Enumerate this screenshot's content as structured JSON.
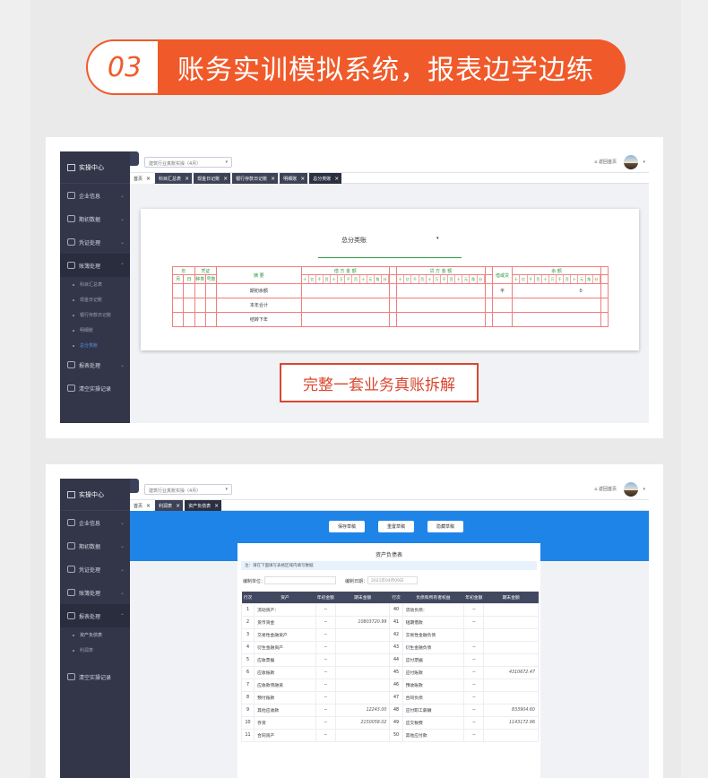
{
  "banner": {
    "number": "03",
    "title": "账务实训模拟系统，报表边学边练"
  },
  "shared": {
    "app_title": "实操中心",
    "menu": [
      "企业信息",
      "期初数据",
      "凭证处理",
      "账簿处理",
      "报表处理",
      "清空实操记录"
    ],
    "industry_select": "建筑行业真账实操（4月）",
    "home_link": "返回首页"
  },
  "shot1": {
    "submenu": [
      "科目汇总表",
      "现金日记账",
      "银行存款日记账",
      "明细账",
      "总分类账"
    ],
    "tabs": [
      "首页",
      "科目汇总表",
      "现金日记账",
      "银行存款日记账",
      "明细账",
      "总分类账"
    ],
    "ledger": {
      "title": "总分类账",
      "dropdown_mark": "▾",
      "year": "年",
      "voucher": "凭证",
      "month": "月",
      "day": "日",
      "kind": "种类",
      "number": "号数",
      "summary": "摘 要",
      "debit": "借 方 金 额",
      "credit": "贷 方 金 额",
      "dc": "借或贷",
      "balance": "余 额",
      "digit_labels": [
        "十",
        "亿",
        "千",
        "百",
        "十",
        "万",
        "千",
        "百",
        "十",
        "元",
        "角",
        "分"
      ],
      "rows": [
        {
          "summary": "期初余额",
          "dc": "平",
          "balance": "0"
        },
        {
          "summary": "本年合计",
          "dc": "",
          "balance": ""
        },
        {
          "summary": "结转下年",
          "dc": "",
          "balance": ""
        }
      ]
    },
    "caption": "完整一套业务真账拆解"
  },
  "shot2": {
    "submenu": [
      "资产负债表",
      "利润表"
    ],
    "tabs": [
      "首页",
      "利润表",
      "资产负债表"
    ],
    "buttons": [
      "保存草稿",
      "重置草稿",
      "隐藏草稿"
    ],
    "report_title": "资产负债表",
    "notice": "注：请在下面填写表格区域内填写数据",
    "unit_label": "编制单位：",
    "date_label": "编制日期：",
    "date_value": "2021年04月09日",
    "columns": [
      "行次",
      "资产",
      "年初金额",
      "期末金额",
      "行次",
      "负债和所有者权益",
      "年初金额",
      "期末金额"
    ],
    "rows": [
      [
        "1",
        "流动资产：",
        "--",
        "",
        "40",
        "流动负债：",
        "--",
        ""
      ],
      [
        "2",
        "货币资金",
        "--",
        "10803720.99",
        "41",
        "短期借款",
        "--",
        ""
      ],
      [
        "3",
        "交易性金融资产",
        "--",
        "",
        "42",
        "交易性金融负债",
        "",
        ""
      ],
      [
        "4",
        "衍生金融资产",
        "--",
        "",
        "43",
        "衍生金融负债",
        "--",
        ""
      ],
      [
        "5",
        "应收票据",
        "--",
        "",
        "44",
        "应付票据",
        "--",
        ""
      ],
      [
        "6",
        "应收账款",
        "--",
        "",
        "45",
        "应付账款",
        "--",
        "4310672.47"
      ],
      [
        "7",
        "应收款项融资",
        "--",
        "",
        "46",
        "预收账款",
        "--",
        ""
      ],
      [
        "8",
        "预付账款",
        "--",
        "",
        "47",
        "合同负债",
        "--",
        ""
      ],
      [
        "9",
        "其他应收款",
        "--",
        "12243.00",
        "48",
        "应付职工薪酬",
        "--",
        "833904.60"
      ],
      [
        "10",
        "存货",
        "--",
        "2150058.02",
        "49",
        "应交税费",
        "--",
        "1143172.96"
      ],
      [
        "11",
        "合同资产",
        "--",
        "",
        "50",
        "其他应付款",
        "--",
        ""
      ]
    ]
  }
}
